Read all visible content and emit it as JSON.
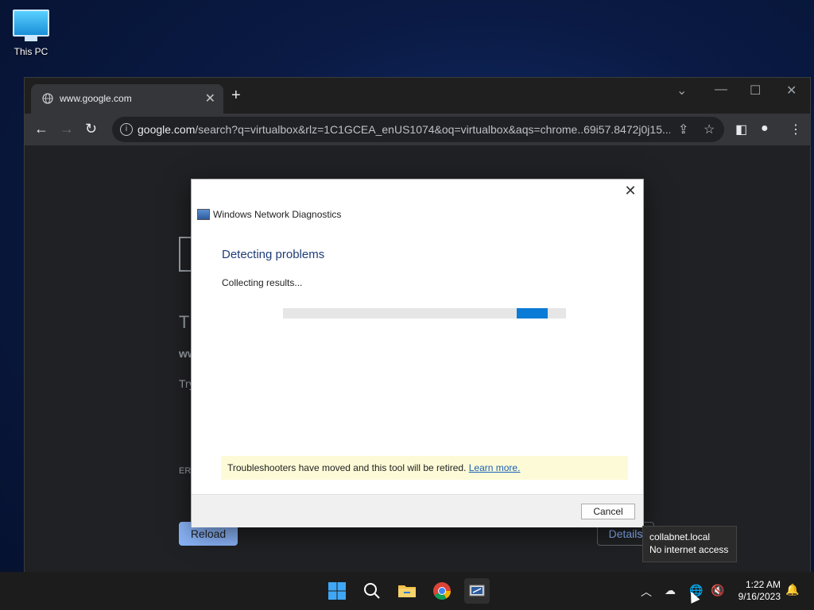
{
  "desktop": {
    "icons": [
      {
        "label": "This PC",
        "icon": "monitor-icon"
      }
    ]
  },
  "browser": {
    "tab": {
      "title": "www.google.com"
    },
    "address": {
      "host": "google.com",
      "path": "/search?q=virtualbox&rlz=1C1GCEA_enUS1074&oq=virtualbox&aqs=chrome..69i57.8472j0j15..."
    },
    "page": {
      "reload_label": "Reload",
      "details_label": "Details",
      "partial_heading": "Th",
      "partial_host": "ww",
      "partial_try": "Try",
      "partial_error": "ERR"
    }
  },
  "dialog": {
    "title": "Windows Network Diagnostics",
    "heading": "Detecting problems",
    "status": "Collecting results...",
    "progress_indeterminate": true,
    "notice_text": "Troubleshooters have moved and this tool will be retired.",
    "notice_link": "Learn more.",
    "cancel_label": "Cancel"
  },
  "tooltip": {
    "line1": "collabnet.local",
    "line2": "No internet access"
  },
  "taskbar": {
    "apps": [
      "start-icon",
      "search-icon",
      "file-explorer-icon",
      "chrome-icon",
      "network-diagnostics-icon"
    ],
    "clock": {
      "time": "1:22 AM",
      "date": "9/16/2023"
    }
  },
  "colors": {
    "accent": "#0a7bd6",
    "notice_bg": "#fdfbd7",
    "link": "#1a5fb4",
    "chrome_blue": "#8ab4f8"
  }
}
